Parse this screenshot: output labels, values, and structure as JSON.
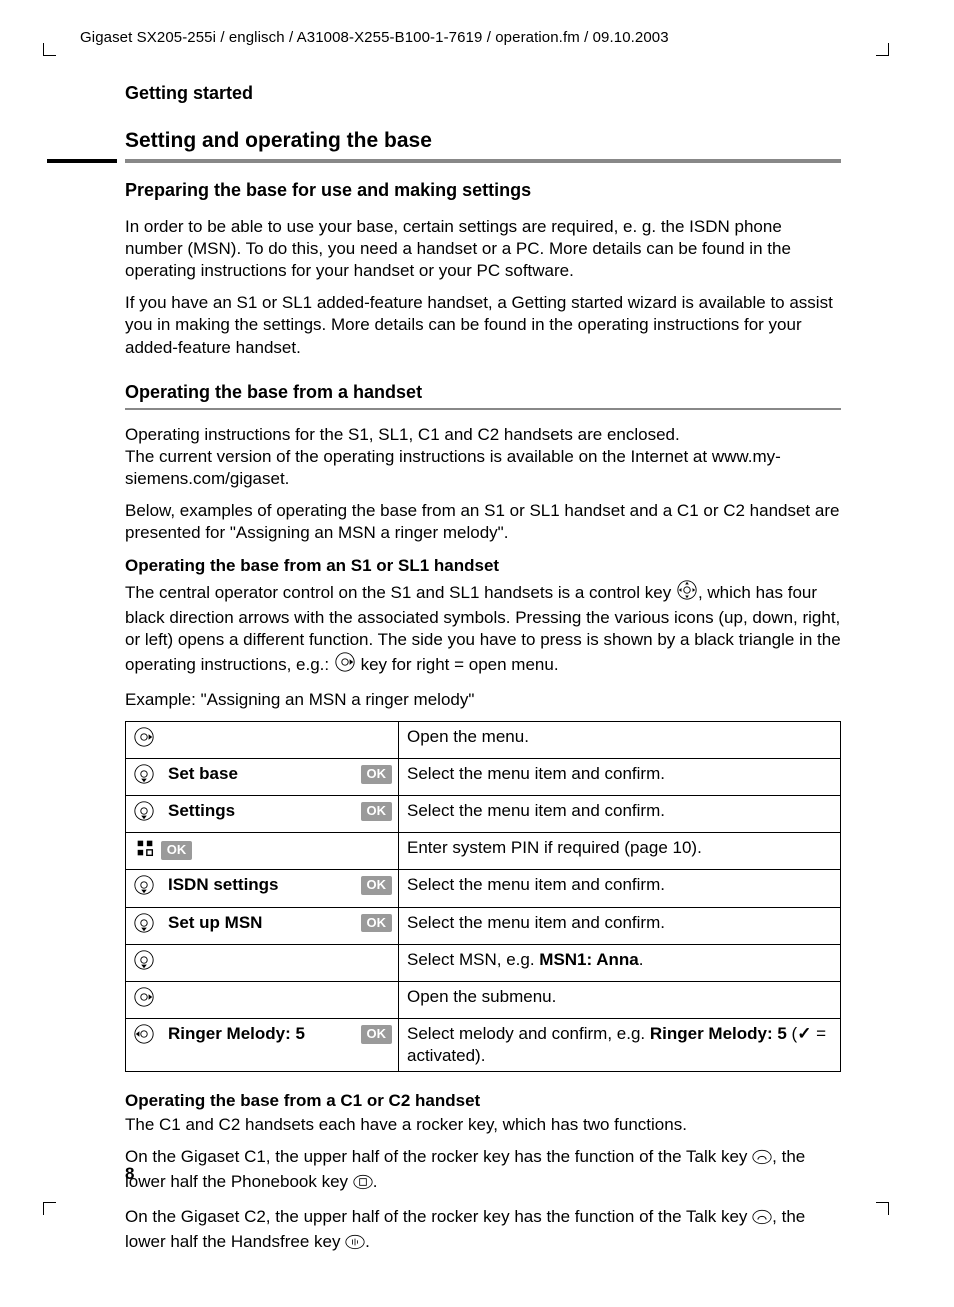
{
  "runhead": "Gigaset SX205-255i / englisch / A31008-X255-B100-1-7619 / operation.fm / 09.10.2003",
  "section_top": "Getting started",
  "h1": "Setting and operating the base",
  "h2a": "Preparing the base for use and making settings",
  "p1": "In order to be able to use your base, certain settings are required, e. g. the ISDN phone number (MSN). To do this, you need a handset or a PC. More details can be found in the operating instructions for your handset or your PC software.",
  "p2": "If you have an S1 or SL1 added-feature handset, a Getting started wizard is available to assist you in making the settings. More details can be found in the operating instructions for your added-feature handset.",
  "h2b": "Operating the base from a handset",
  "p3a": "Operating instructions for the S1, SL1, C1 and C2 handsets are enclosed.",
  "p3b": "The current version of the operating instructions is available on the Internet at www.my-siemens.com/gigaset.",
  "p4": "Below, examples of operating the base from an S1 or SL1 handset and a C1 or C2 handset are presented for \"Assigning an MSN a ringer melody\".",
  "sub1": "Operating the base from an S1 or SL1 handset",
  "p5a": "The central operator control on the S1 and SL1 handsets is a control key ",
  "p5b": ", which has four black direction arrows with the associated symbols. Pressing the various icons (up, down, right, or left) opens a different function. The side you have to press is shown by a black triangle in the operating instructions, e.g.: ",
  "p5c": " key for right = open menu.",
  "p6": "Example: \"Assigning an MSN a ringer melody\"",
  "steps": [
    {
      "icon": "right",
      "label": "",
      "ok": false,
      "desc": "Open the menu."
    },
    {
      "icon": "down",
      "label": "Set base",
      "ok": true,
      "desc": "Select the menu item and confirm."
    },
    {
      "icon": "down",
      "label": "Settings",
      "ok": true,
      "desc": "Select the menu item and confirm."
    },
    {
      "icon": "pin",
      "label": "",
      "ok": true,
      "desc": "Enter system PIN if required (page 10)."
    },
    {
      "icon": "down",
      "label": "ISDN settings",
      "ok": true,
      "desc": "Select the menu item and confirm."
    },
    {
      "icon": "down",
      "label": "Set up MSN",
      "ok": true,
      "desc": "Select the menu item and confirm."
    },
    {
      "icon": "down",
      "label": "",
      "ok": false,
      "desc_pre": "Select MSN, e.g. ",
      "desc_bold": "MSN1: Anna",
      "desc_post": "."
    },
    {
      "icon": "right",
      "label": "",
      "ok": false,
      "desc": "Open the submenu."
    },
    {
      "icon": "left",
      "label": "Ringer Melody: 5",
      "ok": true,
      "desc_pre": "Select melody and confirm, e.g. ",
      "desc_bold": "Ringer Melody: 5",
      "desc_post": " (",
      "desc_check": true,
      "desc_post2": " = activated)."
    }
  ],
  "ok_label": "OK",
  "sub2": "Operating the base from a C1 or C2 handset",
  "p7": "The C1 and C2 handsets each have a rocker key, which has two functions.",
  "p8a": "On the Gigaset C1, the upper half of the rocker key has the function of the Talk key ",
  "p8b": ", the lower half the Phonebook key ",
  "p8c": ".",
  "p9a": "On the Gigaset C2, the upper half of the rocker key has the function of the Talk key ",
  "p9b": ", the lower half the Handsfree key ",
  "p9c": ".",
  "page_number": "8"
}
